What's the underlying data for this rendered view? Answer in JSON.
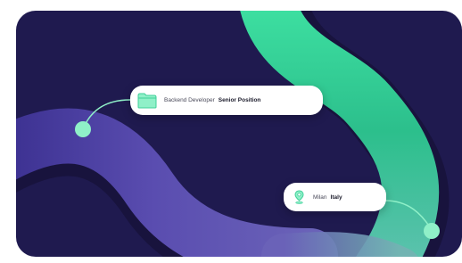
{
  "job_tag": {
    "icon": "folder-icon",
    "role": "Backend Developer",
    "level": "Senior Position"
  },
  "location_tag": {
    "icon": "location-pin-icon",
    "city": "Milan",
    "country": "Italy"
  },
  "colors": {
    "background": "#1f1a4f",
    "accent_green": "#8ff0c8",
    "ribbon_green": "#2fd08f",
    "ribbon_purple": "#5146a8"
  }
}
